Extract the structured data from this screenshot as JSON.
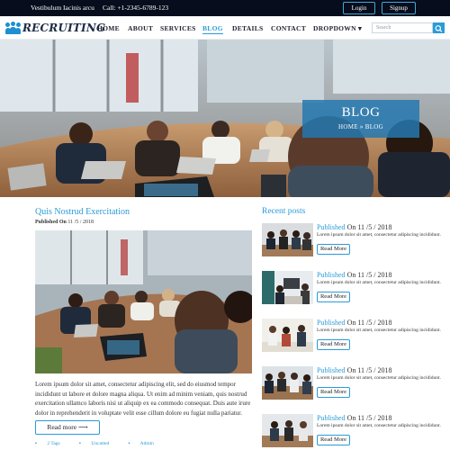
{
  "topbar": {
    "tagline": "Vestibulum Iacinis arcu",
    "phone": "Call: +1-2345-6789-123",
    "login_label": "Login",
    "signup_label": "Signup"
  },
  "brand": {
    "name": "RECRUITING",
    "accent_color": "#2a9bd8",
    "dark_color": "#070d1c"
  },
  "nav": {
    "items": [
      {
        "label": "HOME",
        "active": false
      },
      {
        "label": "ABOUT",
        "active": false
      },
      {
        "label": "SERVICES",
        "active": false
      },
      {
        "label": "BLOG",
        "active": true
      },
      {
        "label": "DETAILS",
        "active": false
      },
      {
        "label": "CONTACT",
        "active": false
      },
      {
        "label": "DROPDOWN ▾",
        "active": false
      }
    ],
    "search_placeholder": "Search",
    "search_icon": "search-icon"
  },
  "hero": {
    "title": "BLOG",
    "breadcrumb": "HOME » BLOG"
  },
  "main_post": {
    "title": "Quis Nostrud Exercitation",
    "published_label": "Published On",
    "published_date": "11 /5 / 2018",
    "body": "Lorem ipsum dolor sit amet, consectetur adipiscing elit, sed do eiusmod tempor incididunt ut labore et dolore magna aliqua. Ut enim ad minim veniam, quis nostrud exercitation ullamco laboris nisi ut aliquip ex ea commodo consequat. Duis aute irure dolor in reprehenderit in voluptate velit esse cillum dolore eu fugiat nulla pariatur.",
    "read_more_label": "Read more ⟶",
    "tags": "2 Tags",
    "category": "Uncatted",
    "author": "Admin"
  },
  "recent_posts": {
    "heading": "Recent posts",
    "items": [
      {
        "published": "Published",
        "date": "On 11 /5 / 2018",
        "desc": "Lorem ipsum dolor sit amet, consectetur adipiscing incididunt.",
        "read_label": "Read More"
      },
      {
        "published": "Published",
        "date": "On 11 /5 / 2018",
        "desc": "Lorem ipsum dolor sit amet, consectetur adipiscing incididunt.",
        "read_label": "Read More"
      },
      {
        "published": "Published",
        "date": "On 11 /5 / 2018",
        "desc": "Lorem ipsum dolor sit amet, consectetur adipiscing incididunt.",
        "read_label": "Read More"
      },
      {
        "published": "Published",
        "date": "On 11 /5 / 2018",
        "desc": "Lorem ipsum dolor sit amet, consectetur adipiscing incididunt.",
        "read_label": "Read More"
      },
      {
        "published": "Published",
        "date": "On 11 /5 / 2018",
        "desc": "Lorem ipsum dolor sit amet, consectetur adipiscing incididunt.",
        "read_label": "Read More"
      }
    ]
  }
}
